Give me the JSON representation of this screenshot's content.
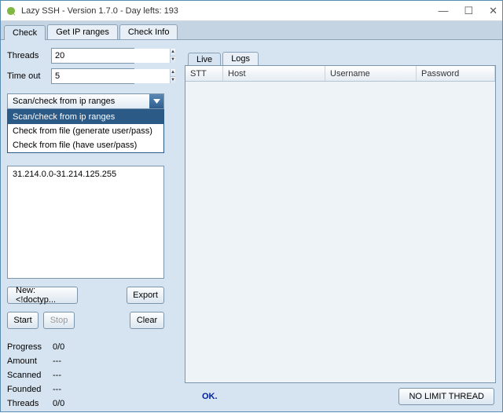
{
  "title": "Lazy SSH - Version 1.7.0 - Day lefts: 193",
  "mainTabs": {
    "check": "Check",
    "getIpRanges": "Get IP ranges",
    "checkInfo": "Check Info"
  },
  "fields": {
    "threadsLabel": "Threads",
    "threadsValue": "20",
    "timeoutLabel": "Time out",
    "timeoutValue": "5"
  },
  "combo": {
    "selected": "Scan/check from ip ranges",
    "options": [
      "Scan/check from ip ranges",
      "Check from file (generate user/pass)",
      "Check from file (have user/pass)"
    ]
  },
  "ipList": {
    "item0": "31.214.0.0-31.214.125.255"
  },
  "buttons": {
    "new": "New: <!doctyp...",
    "export": "Export",
    "start": "Start",
    "stop": "Stop",
    "clear": "Clear",
    "noLimit": "NO LIMIT THREAD"
  },
  "stats": {
    "progressLabel": "Progress",
    "progressValue": "0/0",
    "amountLabel": "Amount",
    "amountValue": "---",
    "scannedLabel": "Scanned",
    "scannedValue": "---",
    "foundedLabel": "Founded",
    "foundedValue": "---",
    "threadsLabel": "Threads",
    "threadsValue": "0/0"
  },
  "subTabs": {
    "live": "Live",
    "logs": "Logs"
  },
  "columns": {
    "stt": "STT",
    "host": "Host",
    "user": "Username",
    "pass": "Password"
  },
  "status": "OK."
}
